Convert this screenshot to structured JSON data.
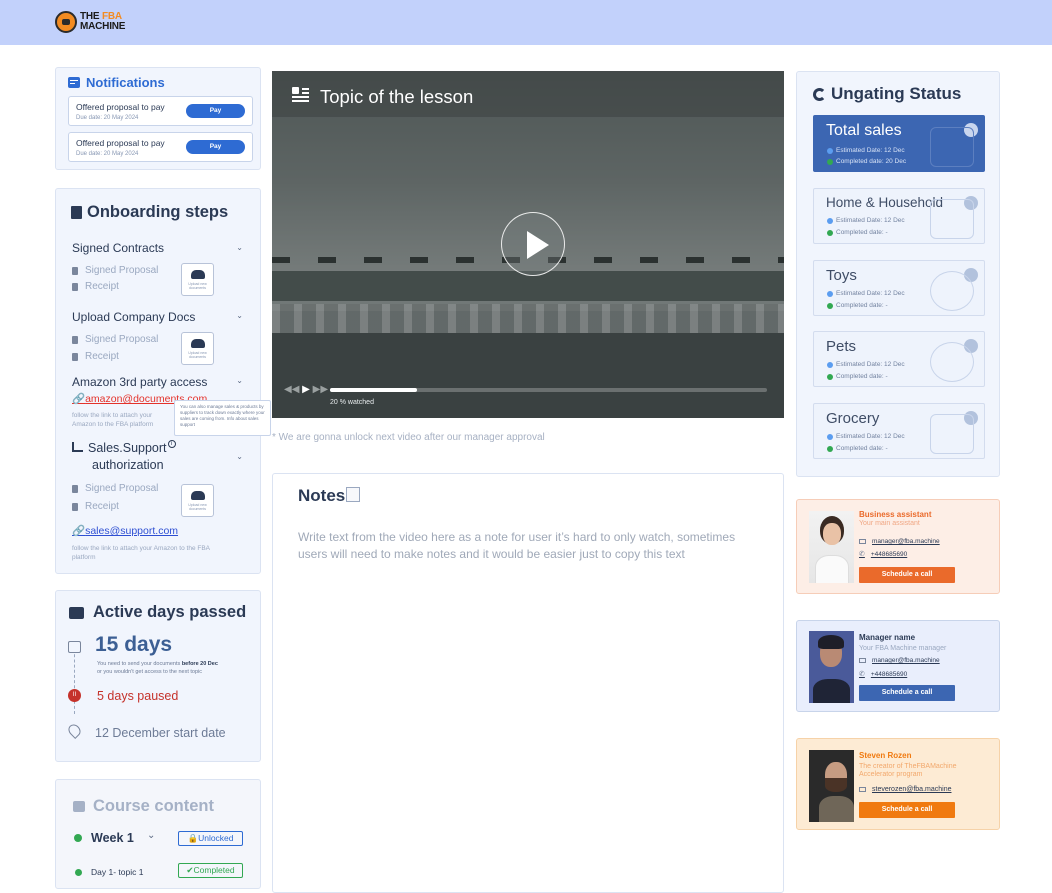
{
  "brand": {
    "line1": "THE",
    "fba": "FBA",
    "line2": "MACHINE"
  },
  "notifications": {
    "title": "Notifications",
    "items": [
      {
        "text": "Offered proposal to pay",
        "due": "Due date: 20 May 2024",
        "action": "Pay"
      },
      {
        "text": "Offered proposal to pay",
        "due": "Due date: 20 May 2024",
        "action": "Pay"
      }
    ]
  },
  "onboarding": {
    "title": "Onboarding steps",
    "sections": [
      {
        "title": "Signed Contracts",
        "items": [
          "Signed Proposal",
          "Receipt"
        ],
        "upload": "Upload new documents"
      },
      {
        "title": "Upload Company Docs",
        "items": [
          "Signed Proposal",
          "Receipt"
        ],
        "upload": "Upload new documents"
      },
      {
        "title": "Amazon 3rd party access",
        "link": "amazon@documents.com",
        "hint": "follow the link to attach your Amazon to the FBA platform"
      },
      {
        "title_line1": "Sales.Support",
        "title_line2": "authorization",
        "items": [
          "Signed Proposal",
          "Receipt"
        ],
        "upload": "Upload new documents",
        "link": "sales@support.com",
        "hint": "follow the link to attach your Amazon to the FBA platform"
      }
    ],
    "tooltip": "You can also manage sales & products by suppliers to track down exactly where your sales are coming from. Info about sales support",
    "info_mark": "i"
  },
  "active_days": {
    "title": "Active days passed",
    "days": "15 days",
    "note_pre": "You need to send your documents ",
    "note_bold": "before 20 Dec",
    "note_post": "or you wouldn't get access to the next topic",
    "paused": "5 days paused",
    "start": "12 December start date"
  },
  "course": {
    "title": "Course content",
    "week": "Week 1",
    "week_badge": "Unlocked",
    "day": "Day 1- topic 1",
    "day_badge": "Completed"
  },
  "video": {
    "title": "Topic of the lesson",
    "progress_percent": 20,
    "watched": "20 % watched",
    "note": "* We are gonna unlock next video after our manager approval"
  },
  "notes": {
    "title": "Notes",
    "body": "Write text from the video here as a note for user it’s hard to only watch, sometimes users will need to make notes and it would be easier just to copy this text"
  },
  "ungating": {
    "title": "Ungating Status",
    "cards": [
      {
        "name": "Total sales",
        "est": "Estimated Date: 12 Dec",
        "comp": "Completed date: 20 Dec",
        "active": true,
        "icon": "money-bag-icon"
      },
      {
        "name": "Home & Household",
        "est": "Estimated Date: 12 Dec",
        "comp": "Completed date: -",
        "active": false,
        "icon": "home-appliance-icon"
      },
      {
        "name": "Toys",
        "est": "Estimated Date: 12 Dec",
        "comp": "Completed date: -",
        "active": false,
        "icon": "teddy-bear-icon"
      },
      {
        "name": "Pets",
        "est": "Estimated Date: 12 Dec",
        "comp": "Completed date: -",
        "active": false,
        "icon": "pet-icon"
      },
      {
        "name": "Grocery",
        "est": "Estimated Date: 12 Dec",
        "comp": "Completed date: -",
        "active": false,
        "icon": "grocery-bag-icon"
      }
    ]
  },
  "contacts": [
    {
      "name": "Business assistant",
      "role": "Your main assistant",
      "email": "manager@fba.machine",
      "phone": "+448685690",
      "action": "Schedule a call",
      "bg": "#fdeee6",
      "border": "#f6cdb8",
      "accent": "#ea6a2b"
    },
    {
      "name": "Manager name",
      "role": "Your FBA Machine manager",
      "email": "manager@fba.machine",
      "phone": "+448685690",
      "action": "Schedule a call",
      "bg": "#e9eefc",
      "border": "#c8d4ea",
      "accent": "#3c66b2"
    },
    {
      "name": "Steven Rozen",
      "role": "The creator of TheFBAMachine Accelerator program",
      "email": "steverozen@fba.machine",
      "action": "Schedule a call",
      "bg": "#fdebd4",
      "border": "#f6d2a8",
      "accent": "#f07a10"
    }
  ],
  "colors": {
    "primary": "#2e6bd3",
    "danger": "#c5322b",
    "success": "#32a852",
    "orange": "#ea6a2b"
  }
}
